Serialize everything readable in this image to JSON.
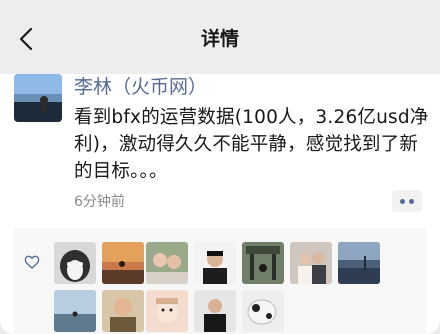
{
  "nav": {
    "title": "详情",
    "back_icon": "chevron-left-icon"
  },
  "post": {
    "author": "李林（火币网）",
    "content": "看到bfx的运营数据(100人，3.26亿usd净利)，激动得久久不能平静，感觉找到了新的目标。。。",
    "time": "6分钟前",
    "more_icon": "more-dots-icon"
  },
  "likes": {
    "icon": "heart-outline-icon",
    "count": 11
  },
  "colors": {
    "link": "#576b95",
    "nav_bg": "#ededed",
    "likes_bg": "#f7f7f7"
  }
}
